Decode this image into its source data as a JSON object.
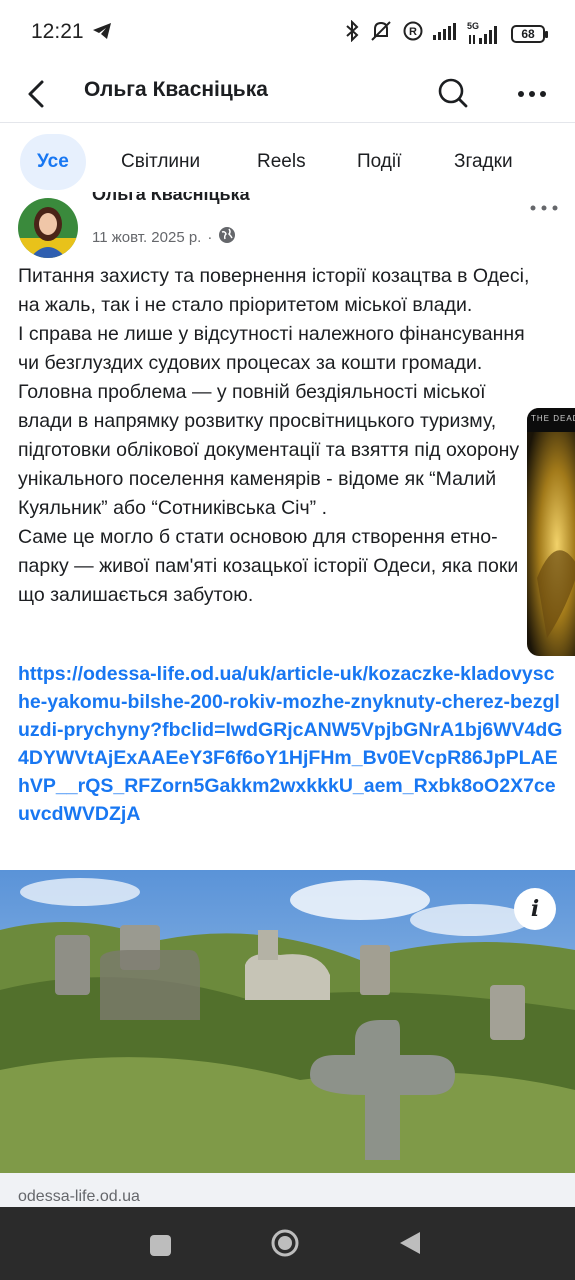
{
  "status": {
    "time": "12:21",
    "network": "5G",
    "battery": "68"
  },
  "header": {
    "title": "Ольга Квасніцька"
  },
  "tabs": [
    {
      "label": "Усе"
    },
    {
      "label": "Світлини"
    },
    {
      "label": "Reels"
    },
    {
      "label": "Події"
    },
    {
      "label": "Згадки"
    }
  ],
  "post": {
    "author": "Ольга Квасніцька",
    "date": "11 жовт. 2025 р.",
    "separator": "·",
    "text": "Питання захисту та повернення історії козацтва в Одесі, на жаль, так і не стало пріоритетом міської влади.\nІ справа не лише у відсутності належного фінансування чи безглуздих судових процесах за кошти громади. Головна проблема — у повній бездіяльності міської влади в напрямку розвитку просвітницького туризму, підготовки облікової документації та взяття під охорону унікального поселення каменярів - відоме як “Малий Куяльник” або “Сотниківська Січ” .\nСаме це могло б стати основою для створення етно-парку — живої пам'яті козацької історії Одеси, яка поки що залишається забутою.",
    "link": "https://odessa-life.od.ua/uk/article-uk/kozaczke-kladovysche-yakomu-bilshe-200-rokiv-mozhe-znyknuty-cherez-bezgluzdi-prychyny?fbclid=IwdGRjcANW5VpjbGNrA1bj6WV4dG4DYWVtAjExAAEeY3F6f6oY1HjFHm_Bv0EVcpR86JpPLAEhVP__rQS_RFZorn5Gakkm2wxkkkU_aem_Rxbk8oO2X7ceuvcdWVDZjA",
    "thumb_text": "THE DEAD",
    "info_label": "i",
    "link_domain": "odessa-life.od.ua"
  }
}
